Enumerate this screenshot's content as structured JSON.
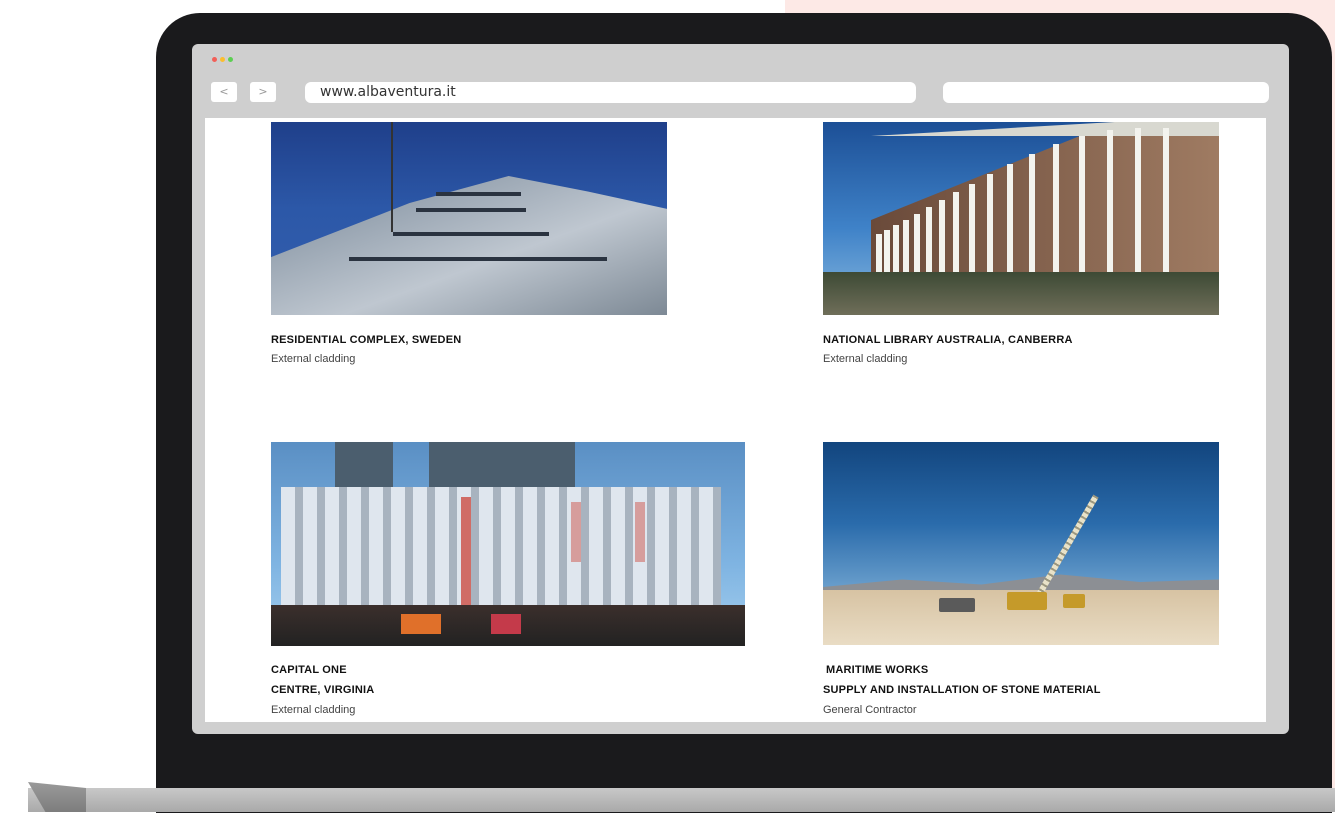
{
  "browser": {
    "nav_back": "<",
    "nav_forward": ">",
    "url": "www.albaventura.it",
    "traffic_lights": [
      "#f25f58",
      "#fbbe2e",
      "#5ccf52"
    ]
  },
  "projects": [
    {
      "title_lines": [
        "RESIDENTIAL COMPLEX, SWEDEN"
      ],
      "subtitle": "External cladding"
    },
    {
      "title_lines": [
        "NATIONAL LIBRARY AUSTRALIA, CANBERRA"
      ],
      "subtitle": "External cladding"
    },
    {
      "title_lines": [
        "CAPITAL ONE",
        "CENTRE, VIRGINIA"
      ],
      "subtitle": "External cladding"
    },
    {
      "title_lines": [
        "MARITIME WORKS",
        "SUPPLY AND INSTALLATION OF STONE MATERIAL"
      ],
      "subtitle": "General Contractor"
    }
  ]
}
